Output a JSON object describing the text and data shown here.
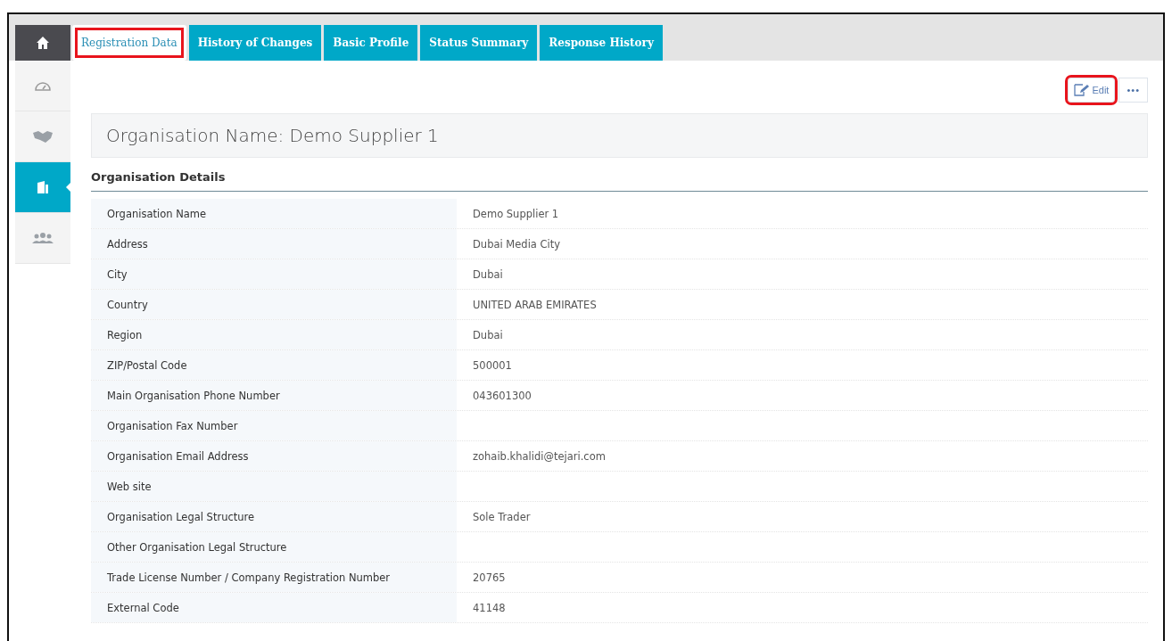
{
  "sidebar": {
    "items": [
      {
        "kind": "home",
        "selected": false
      },
      {
        "kind": "gauge",
        "selected": false
      },
      {
        "kind": "handshake",
        "selected": false
      },
      {
        "kind": "building",
        "selected": true
      },
      {
        "kind": "people",
        "selected": false
      }
    ]
  },
  "tabs": [
    {
      "label": "Registration Data",
      "selected": true,
      "highlighted": true
    },
    {
      "label": "History of Changes",
      "selected": false,
      "highlighted": false
    },
    {
      "label": "Basic Profile",
      "selected": false,
      "highlighted": false
    },
    {
      "label": "Status Summary",
      "selected": false,
      "highlighted": false
    },
    {
      "label": "Response History",
      "selected": false,
      "highlighted": false
    }
  ],
  "toolbar": {
    "edit": {
      "label": "Edit",
      "highlighted": true
    },
    "more": "•••"
  },
  "header": "Organisation Name: Demo Supplier 1",
  "section": {
    "title": "Organisation Details",
    "rows": [
      {
        "label": "Organisation Name",
        "value": "Demo Supplier 1"
      },
      {
        "label": "Address",
        "value": "Dubai Media City"
      },
      {
        "label": "City",
        "value": "Dubai"
      },
      {
        "label": "Country",
        "value": "UNITED ARAB EMIRATES"
      },
      {
        "label": "Region",
        "value": "Dubai"
      },
      {
        "label": "ZIP/Postal Code",
        "value": "500001"
      },
      {
        "label": "Main Organisation Phone Number",
        "value": "043601300"
      },
      {
        "label": "Organisation Fax Number"
      },
      {
        "label": "Organisation Email Address",
        "value": "zohaib.khalidi@tejari.com"
      },
      {
        "label": "Web site"
      },
      {
        "label": "Organisation Legal Structure",
        "value": "Sole Trader"
      },
      {
        "label": "Other Organisation Legal Structure"
      },
      {
        "label": "Trade License Number / Company Registration Number",
        "value": "20765"
      },
      {
        "label": "External Code",
        "value": "41148"
      }
    ]
  }
}
